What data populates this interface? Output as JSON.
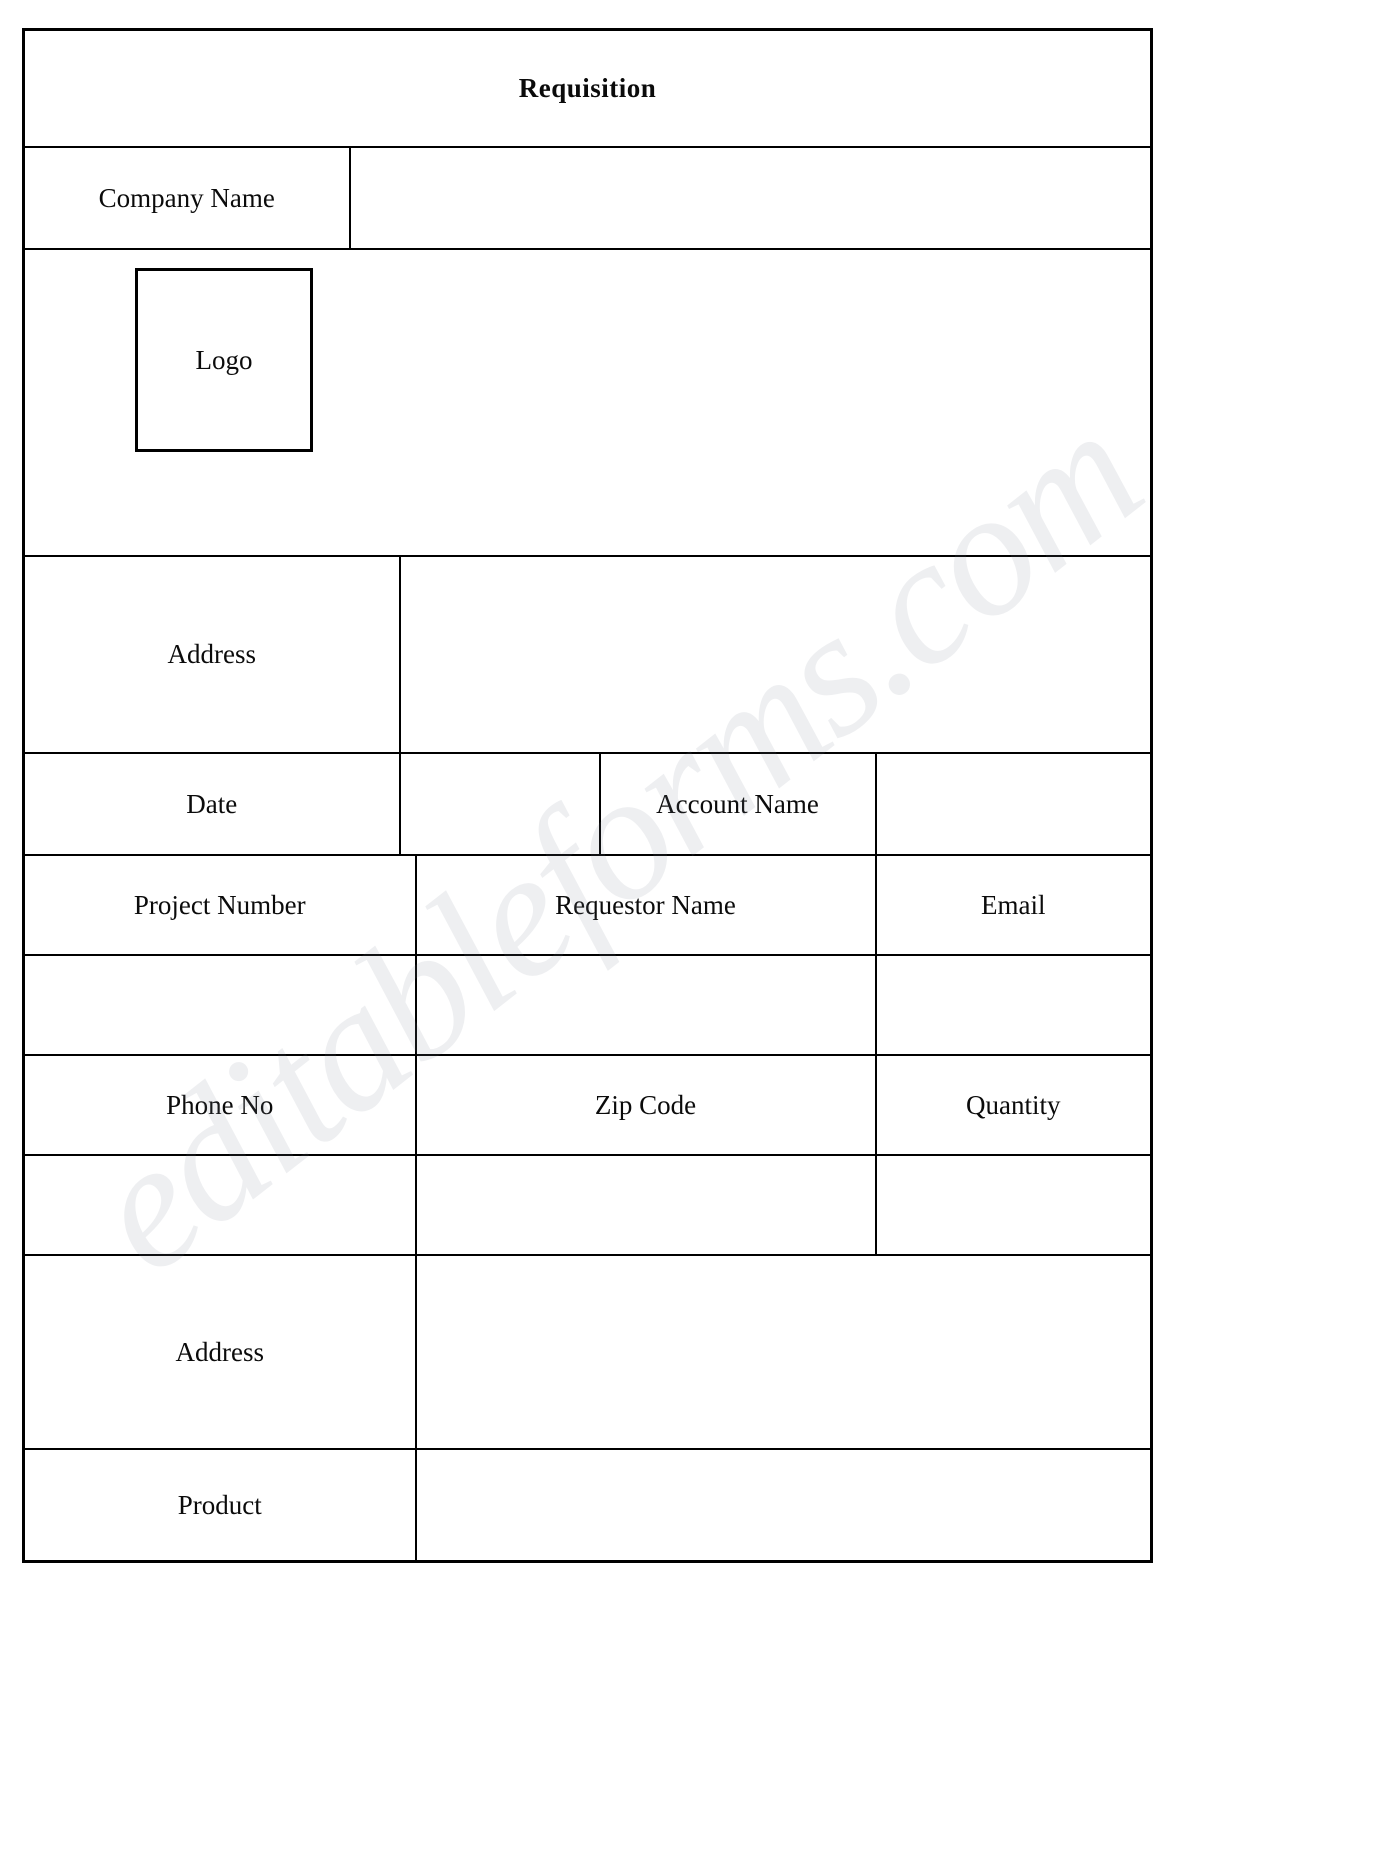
{
  "document": {
    "title": "Requisition",
    "watermark": "editableforms.com"
  },
  "colors": {
    "title_bar": "#8cb1e2",
    "field_fill": "#d3dcea",
    "blank_fill": "#ffffff",
    "border": "#000000",
    "text": "#0b0b0b"
  },
  "rows": {
    "company": {
      "label": "Company Name",
      "value": ""
    },
    "logo": {
      "label": "Logo"
    },
    "address_top": {
      "label": "Address",
      "value": ""
    },
    "date_account": {
      "date_label": "Date",
      "date_value": "",
      "account_label": "Account Name",
      "account_value": ""
    },
    "project_header": {
      "col1": "Project Number",
      "col2": "Requestor Name",
      "col3": "Email"
    },
    "project_values": {
      "col1": "",
      "col2": "",
      "col3": ""
    },
    "contact_header": {
      "col1": "Phone No",
      "col2": "Zip Code",
      "col3": "Quantity"
    },
    "contact_values": {
      "col1": "",
      "col2": "",
      "col3": ""
    },
    "address_bottom": {
      "label": "Address",
      "value": ""
    },
    "product": {
      "label": "Product",
      "value": ""
    }
  }
}
